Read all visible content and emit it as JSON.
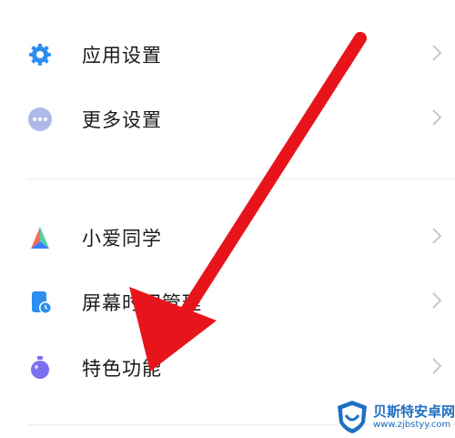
{
  "settings": {
    "items": [
      {
        "label": "应用设置",
        "icon": "gear-icon"
      },
      {
        "label": "更多设置",
        "icon": "more-dots-icon"
      },
      {
        "label": "小爱同学",
        "icon": "xiaoai-icon"
      },
      {
        "label": "屏幕时间管理",
        "icon": "screen-time-icon"
      },
      {
        "label": "特色功能",
        "icon": "feature-flask-icon"
      }
    ]
  },
  "watermark": {
    "title": "贝斯特安卓网",
    "url": "www.zjbstyy.com"
  },
  "colors": {
    "accent_blue": "#2b8ff0",
    "arrow_red": "#e8141c",
    "watermark_blue": "#1f6fc0"
  }
}
